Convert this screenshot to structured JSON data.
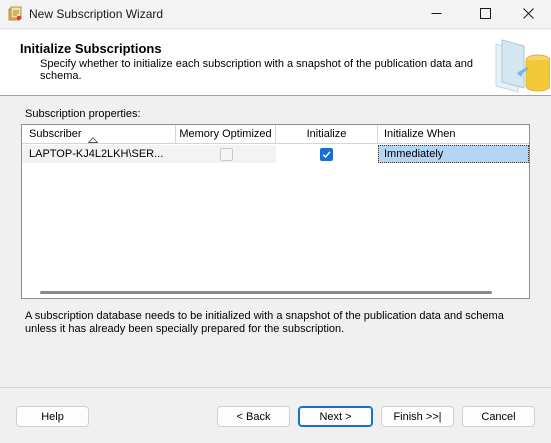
{
  "window": {
    "title": "New Subscription Wizard",
    "minimize_glyph": "—",
    "maximize_glyph": "☐",
    "close_glyph": "✕"
  },
  "header": {
    "title": "Initialize Subscriptions",
    "description": "Specify whether to initialize each subscription with a snapshot of the publication data and schema."
  },
  "grid": {
    "section_label": "Subscription properties:",
    "columns": [
      "Subscriber",
      "Memory Optimized",
      "Initialize",
      "Initialize When"
    ],
    "rows": [
      {
        "subscriber": "LAPTOP-KJ4L2LKH\\SER...",
        "memory_optimized": false,
        "initialize": true,
        "initialize_when": "Immediately"
      }
    ]
  },
  "info_text": "A subscription database needs to be initialized with a snapshot of the publication data and schema unless it has already been specially prepared for the subscription.",
  "buttons": {
    "help": "Help",
    "back": "< Back",
    "next": "Next >",
    "finish": "Finish >>|",
    "cancel": "Cancel"
  },
  "colors": {
    "accent": "#1a6dd4",
    "selection": "#b5d5f5"
  }
}
